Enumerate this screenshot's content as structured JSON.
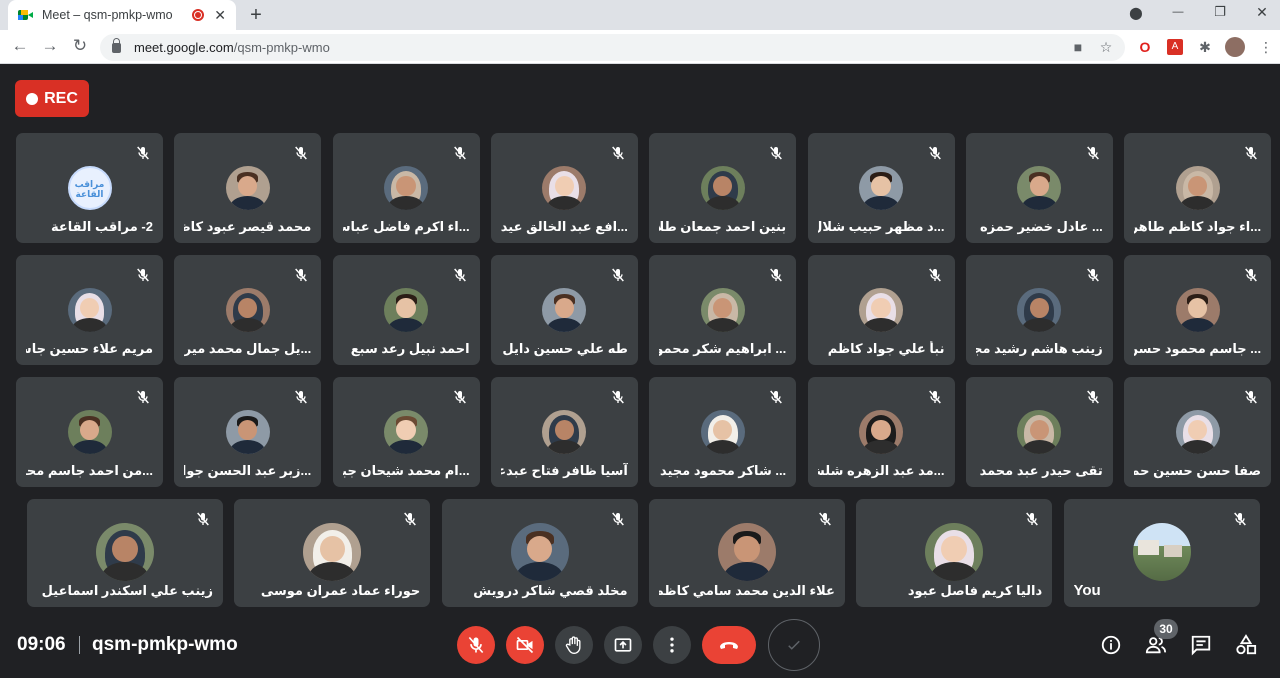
{
  "browser": {
    "tab_title": "Meet – qsm-pmkp-wmo",
    "tab_close": "✕",
    "new_tab": "+",
    "url_host": "meet.google.com",
    "url_path": "/qsm-pmkp-wmo",
    "minimize": "—",
    "maximize": "❐",
    "close": "✕"
  },
  "meet": {
    "rec_label": "REC",
    "time": "09:06",
    "meeting_code": "qsm-pmkp-wmo",
    "participant_count": "30"
  },
  "colors": {
    "background": "#202124",
    "tile": "#3c4043",
    "rec_red": "#d93025",
    "end_call_red": "#ea4335"
  },
  "participants": [
    {
      "name": "2- مراقب القاعة",
      "av": "logo"
    },
    {
      "name": "محمد قيصر عبود كاظم",
      "av": "m"
    },
    {
      "name": "...اء اكرم فاضل عباس",
      "av": "f"
    },
    {
      "name": "...افع عبد الخالق عيدان",
      "av": "f"
    },
    {
      "name": "بنين احمد جمعان طلاع",
      "av": "f"
    },
    {
      "name": "...د مظهر حبيب شلال",
      "av": "m"
    },
    {
      "name": "... عادل خضير حمزه",
      "av": "m"
    },
    {
      "name": "...اء جواد كاظم طاهر",
      "av": "f"
    },
    {
      "name": "مريم علاء حسين جاسم",
      "av": "f"
    },
    {
      "name": "...يل جمال محمد ميرزا",
      "av": "f"
    },
    {
      "name": "احمد نبيل رعد سبع",
      "av": "m"
    },
    {
      "name": "طه علي حسين دايل",
      "av": "m"
    },
    {
      "name": "... ابراهيم شكر محمود",
      "av": "f"
    },
    {
      "name": "نبأ علي جواد كاظم",
      "av": "f"
    },
    {
      "name": "زينب هاشم رشيد مجيد",
      "av": "f"
    },
    {
      "name": "... جاسم محمود حسن",
      "av": "m"
    },
    {
      "name": "...من احمد جاسم محمد",
      "av": "m"
    },
    {
      "name": "...زبر عبد الحسن جواد",
      "av": "m"
    },
    {
      "name": "...ام محمد شيحان جبر",
      "av": "m"
    },
    {
      "name": "آسيا ظافر فتاح عبدعلي",
      "av": "f"
    },
    {
      "name": "... شاكر محمود مجيد",
      "av": "f"
    },
    {
      "name": "...مد عبد الزهره شلش",
      "av": "f"
    },
    {
      "name": "تقى حيدر عبد محمد",
      "av": "f"
    },
    {
      "name": "صفا حسن حسين حمد",
      "av": "f"
    },
    {
      "name": "زينب علي اسكندر اسماعيل",
      "av": "f"
    },
    {
      "name": "حوراء عماد عمران موسى",
      "av": "f"
    },
    {
      "name": "مخلد قصي شاكر درويش",
      "av": "m"
    },
    {
      "name": "علاء الدين محمد سامي كاظم",
      "av": "m"
    },
    {
      "name": "داليا كريم فاصل عبود",
      "av": "f"
    },
    {
      "name": "You",
      "av": "self"
    }
  ],
  "icons": {
    "mic_off": "mic-off-icon",
    "camera_off": "camera-off-icon",
    "raise_hand": "hand-icon",
    "present": "present-screen-icon",
    "more": "more-vert-icon",
    "end_call": "phone-hangup-icon",
    "info": "info-icon",
    "people": "people-icon",
    "chat": "chat-icon",
    "activities": "shapes-icon"
  }
}
